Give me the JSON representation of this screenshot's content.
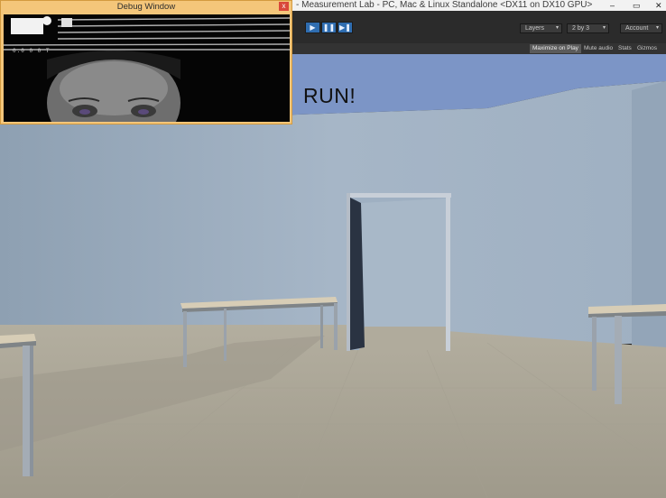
{
  "window": {
    "title": "- Measurement Lab - PC, Mac & Linux Standalone <DX11 on DX10 GPU>",
    "minimize_glyph": "–",
    "maximize_glyph": "▭",
    "close_glyph": "✕"
  },
  "toolbar": {
    "play_glyph": "▶",
    "pause_glyph": "❚❚",
    "step_glyph": "▶❚",
    "layers_label": "Layers",
    "layout_label": "2 by 3",
    "account_label": "Account"
  },
  "game_toolbar": {
    "maximize_on_play": "Maximize on Play",
    "mute_audio": "Mute audio",
    "stats": "Stats",
    "gizmos": "Gizmos"
  },
  "game": {
    "hud_text": "RUN!"
  },
  "debug_window": {
    "title": "Debug Window",
    "close_glyph": "x",
    "readout": "0.0 0 0 T"
  },
  "colors": {
    "editor_dark": "#2b2b2b",
    "play_active": "#2f6db0",
    "debug_frame": "#f4c67a",
    "sky": "#7d95c4",
    "wall": "#9fb0c2",
    "floor": "#a9a393"
  },
  "icons": {
    "play": "play-icon",
    "pause": "pause-icon",
    "step": "step-icon",
    "close": "close-icon",
    "caret": "chevron-down-icon"
  }
}
